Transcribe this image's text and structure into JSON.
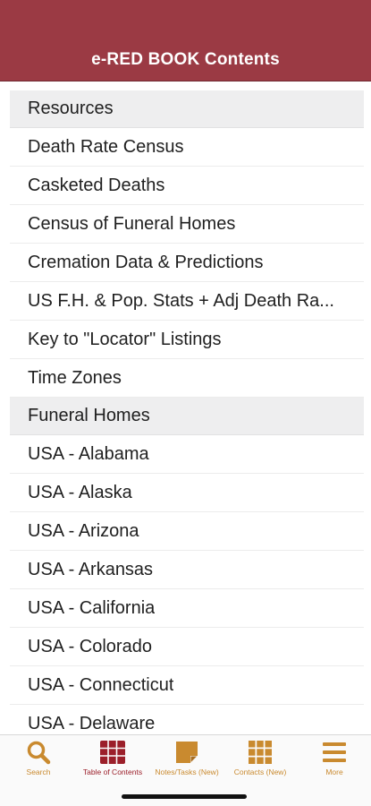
{
  "header": {
    "title": "e-RED BOOK Contents"
  },
  "sections": [
    {
      "title": "Resources",
      "items": [
        "Death Rate Census",
        "Casketed Deaths",
        "Census of Funeral Homes",
        "Cremation Data & Predictions",
        "US F.H. & Pop. Stats + Adj Death Ra...",
        "Key to \"Locator\" Listings",
        "Time Zones"
      ]
    },
    {
      "title": "Funeral Homes",
      "items": [
        "USA - Alabama",
        "USA - Alaska",
        "USA - Arizona",
        "USA - Arkansas",
        "USA - California",
        "USA - Colorado",
        "USA - Connecticut",
        "USA - Delaware"
      ]
    }
  ],
  "tabbar": {
    "items": [
      {
        "label": "Search",
        "icon": "search-icon"
      },
      {
        "label": "Table of Contents",
        "icon": "table-of-contents-icon"
      },
      {
        "label": "Notes/Tasks (New)",
        "icon": "note-icon"
      },
      {
        "label": "Contacts (New)",
        "icon": "contacts-grid-icon"
      },
      {
        "label": "More",
        "icon": "menu-icon"
      }
    ],
    "active_index": 1
  },
  "colors": {
    "header_bg": "#9b3a44",
    "accent_gold": "#c98a2f",
    "active_red": "#9b1f2a"
  }
}
